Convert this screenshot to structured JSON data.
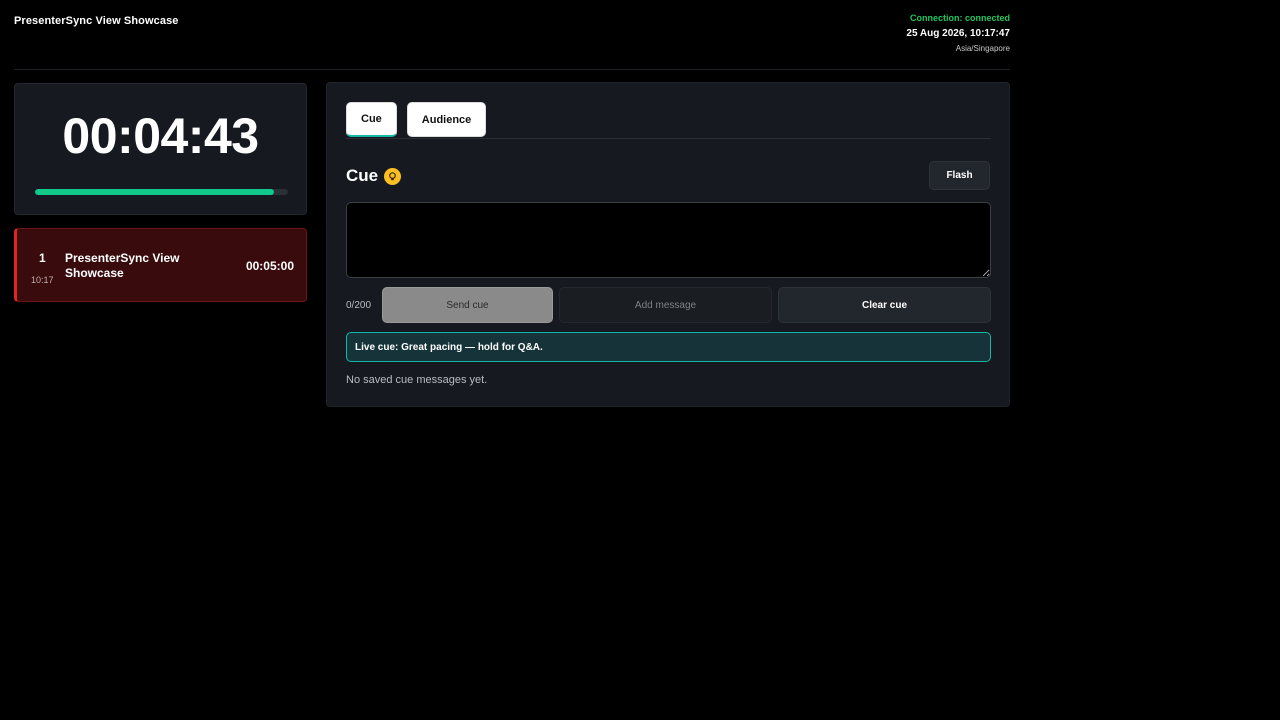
{
  "header": {
    "title": "PresenterSync View Showcase",
    "connection_status": "Connection: connected",
    "datetime": "25 Aug 2026, 10:17:47",
    "timezone": "Asia/Singapore"
  },
  "timer": {
    "display": "00:04:43",
    "progress_fraction": 0.943
  },
  "segments": [
    {
      "index": "1",
      "start": "10:17",
      "title": "PresenterSync View Showcase",
      "duration": "00:05:00"
    }
  ],
  "tabs": [
    {
      "label": "Cue",
      "active": true
    },
    {
      "label": "Audience",
      "active": false
    }
  ],
  "cue_panel": {
    "title": "Cue",
    "flash_label": "Flash",
    "input_value": "",
    "char_count": "0/200",
    "send_label": "Send cue",
    "add_label": "Add message",
    "clear_label": "Clear cue",
    "live_cue": "Live cue: Great pacing — hold for Q&A.",
    "empty_saved": "No saved cue messages yet."
  },
  "colors": {
    "connected": "#22c55e",
    "progress": "#10c98a",
    "accent": "#14b8a6",
    "active_segment": "#dc2626",
    "bulb": "#fbbf24"
  },
  "icons": {
    "title_icon": "lightbulb-icon"
  }
}
